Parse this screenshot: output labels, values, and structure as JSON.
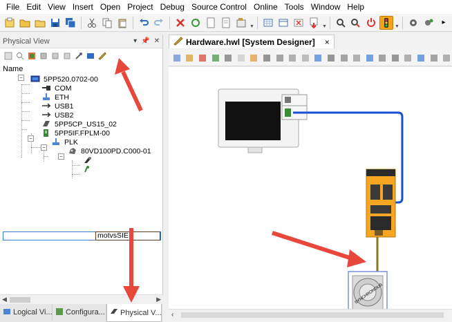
{
  "menu": [
    "File",
    "Edit",
    "View",
    "Insert",
    "Open",
    "Project",
    "Debug",
    "Source Control",
    "Online",
    "Tools",
    "Window",
    "Help"
  ],
  "physical_view": {
    "title": "Physical View",
    "column_header": "Name",
    "tree": [
      {
        "label": "5PP520.0702-00",
        "icon": "panel-pc-icon"
      },
      {
        "label": "COM",
        "icon": "serial-port-icon"
      },
      {
        "label": "ETH",
        "icon": "ethernet-icon"
      },
      {
        "label": "USB1",
        "icon": "usb-icon"
      },
      {
        "label": "USB2",
        "icon": "usb-icon"
      },
      {
        "label": "5PP5CP_US15_02",
        "icon": "module-icon"
      },
      {
        "label": "5PP5IF.FPLM-00",
        "icon": "interface-card-icon"
      },
      {
        "label": "PLK",
        "icon": "powerlink-icon"
      },
      {
        "label": "80VD100PD.C000-01",
        "icon": "drive-icon"
      },
      {
        "label": "motvsSIE",
        "icon": "motor-icon"
      },
      {
        "label": "",
        "icon": "encoder-icon"
      }
    ],
    "bottom_tabs": [
      "Logical Vi...",
      "Configura...",
      "Physical V..."
    ]
  },
  "editor": {
    "tab_title": "Hardware.hwl [System Designer]",
    "tab_close": "×",
    "motor_label": "SYNCHRONOUS"
  },
  "colors": {
    "accent_red": "#e8473c",
    "selection_blue": "#3a7bd5",
    "cable_blue": "#1a4fd0",
    "cable_olive": "#8a7a1a",
    "drive_orange": "#f5a623"
  }
}
